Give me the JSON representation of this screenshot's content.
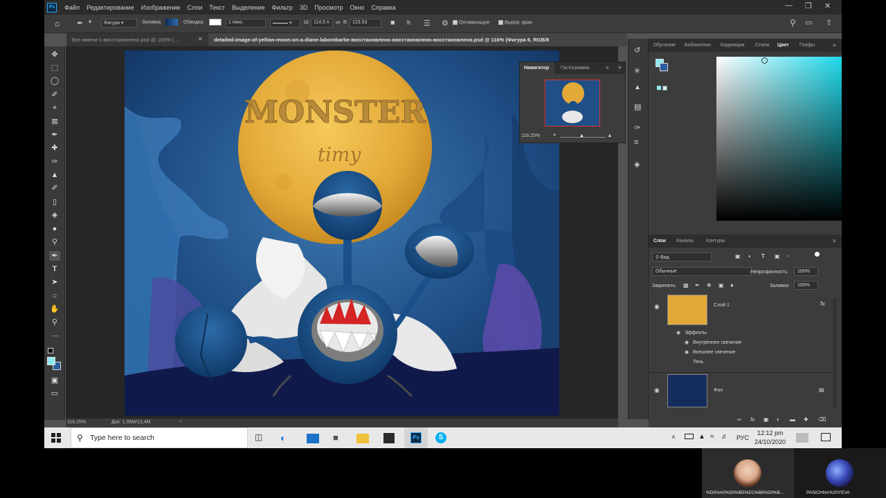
{
  "menubar": {
    "logo": "Ps",
    "items": [
      "Файл",
      "Редактирование",
      "Изображение",
      "Слои",
      "Текст",
      "Выделение",
      "Фильтр",
      "3D",
      "Просмотр",
      "Окно",
      "Справка"
    ]
  },
  "options": {
    "shape_mode": "Фигура",
    "fill_label": "Заливка:",
    "stroke_label": "Обводка:",
    "stroke_width": "1 пикс.",
    "w_label": "Ш:",
    "w_value": "114.5 п",
    "h_label": "В:",
    "h_value": "123.53",
    "optimize_label": "Оптимизация",
    "align_edges_label": "Выров. края"
  },
  "tabs": [
    {
      "label": "Без имени-1-восстановлено.psd @ 100% (..."
    },
    {
      "label": "detailed-image-of-yellow-moon-on-a-diane-labombarbe-восстановлено-восстановлено-восстановлено.psd @ 116% (Фигура 6, RGB/8"
    }
  ],
  "artwork": {
    "title": "MONSTER",
    "subtitle": "timy"
  },
  "navigator": {
    "tab_active": "Навигатор",
    "tab_other": "Гистограмма",
    "zoom": "116.25%"
  },
  "color_panel": {
    "tabs": [
      "Обучение",
      "Библиотеки",
      "Коррекции",
      "Стили",
      "Цвет",
      "Глифы"
    ],
    "active_tab": "Цвет"
  },
  "layers_panel": {
    "tabs": [
      "Слои",
      "Каналы",
      "Контуры"
    ],
    "filter_label": "Вид",
    "blend_mode": "Обычные",
    "opacity_label": "Непрозрачность:",
    "opacity_value": "100%",
    "lock_label": "Закрепить:",
    "fill_label": "Заливка:",
    "fill_value": "100%",
    "layers": [
      {
        "name": "Слой 1",
        "fx": "fx",
        "effects_label": "Эффекты",
        "effects": [
          "Внутреннее свечение",
          "Внешнее свечение",
          "Тень"
        ]
      },
      {
        "name": "Фон"
      }
    ]
  },
  "status": {
    "zoom": "116.25%",
    "doc": "Док: 1,95M/13,4M"
  },
  "taskbar": {
    "search_placeholder": "Type here to search",
    "language": "РУС",
    "time": "12:12 pm",
    "date": "24/10/2020"
  },
  "video": {
    "participant1": "%D0%A0%D0%B5%D1%88%D0%B...",
    "participant2": "PASICHNA%20YEVA"
  },
  "colors": {
    "accent": "#31a8ff",
    "moon": "#e8b84a",
    "canvas_bg": "#1a3a66"
  }
}
